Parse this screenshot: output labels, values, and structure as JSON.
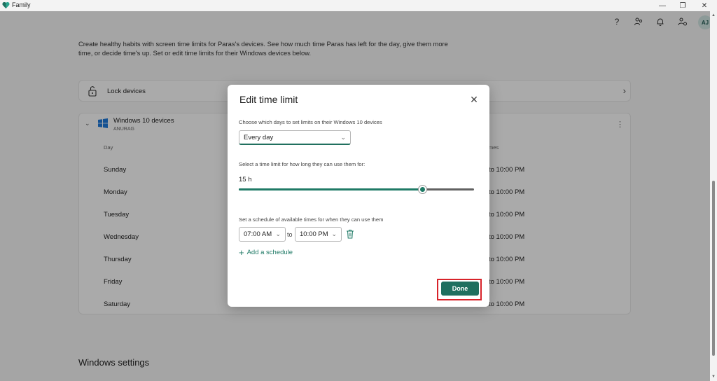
{
  "window": {
    "title": "Family",
    "controls": [
      "—",
      "❐",
      "✕"
    ]
  },
  "page": {
    "intro": "Create healthy habits with screen time limits for Paras's devices. See how much time Paras has left for the day, give them more time, or decide time's up. Set or edit time limits for their Windows devices below.",
    "lock_devices_label": "Lock devices",
    "device_card": {
      "title": "Windows 10 devices",
      "subtitle": "ANURAG",
      "col_day": "Day",
      "col_times": "mes",
      "rows": [
        {
          "day": "Sunday",
          "time": "to 10:00 PM"
        },
        {
          "day": "Monday",
          "time": "to 10:00 PM"
        },
        {
          "day": "Tuesday",
          "time": "to 10:00 PM"
        },
        {
          "day": "Wednesday",
          "time": "to 10:00 PM"
        },
        {
          "day": "Thursday",
          "time": "to 10:00 PM"
        },
        {
          "day": "Friday",
          "time": "to 10:00 PM"
        },
        {
          "day": "Saturday",
          "time": "to 10:00 PM"
        }
      ]
    },
    "windows_settings_title": "Windows settings",
    "avatar_initials": "AJ"
  },
  "dialog": {
    "title": "Edit time limit",
    "days_label": "Choose which days to set limits on their Windows 10 devices",
    "days_value": "Every day",
    "limit_label": "Select a time limit for how long they can use them for:",
    "limit_value": "15 h",
    "limit_fraction": 0.78,
    "schedule_label": "Set a schedule of available times for when they can use them",
    "start_time": "07:00 AM",
    "to_label": "to",
    "end_time": "10:00 PM",
    "add_schedule_label": "Add a schedule",
    "done_label": "Done"
  },
  "colors": {
    "accent": "#1f6f5f",
    "highlight": "#d8232a"
  }
}
